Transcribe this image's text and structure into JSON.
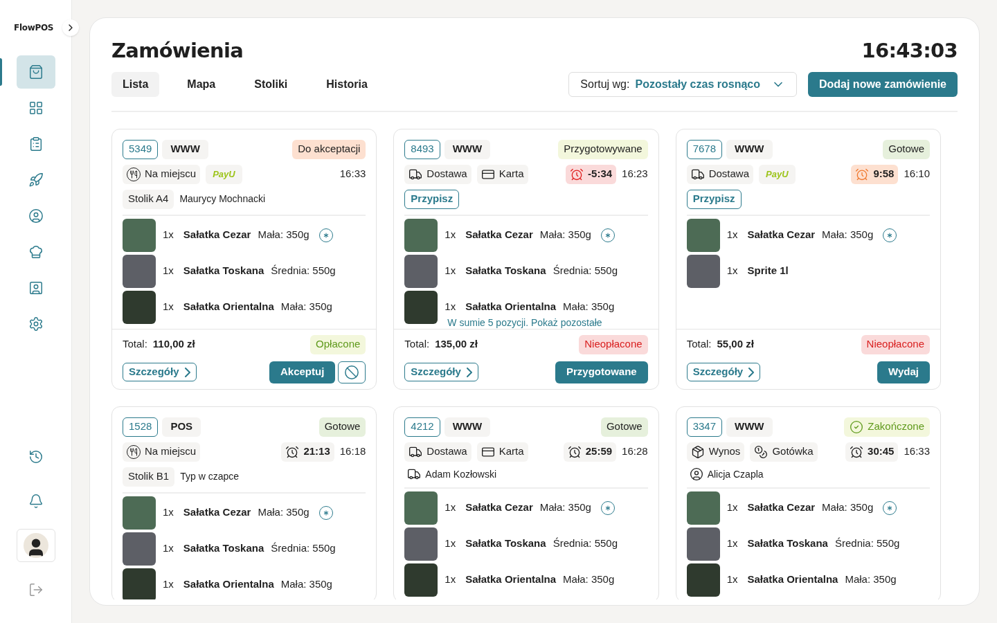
{
  "sidebar": {
    "logo": "FlowPOS",
    "nav_items": [
      {
        "selected": true
      },
      {
        "selected": false
      },
      {
        "selected": false
      },
      {
        "selected": false
      },
      {
        "selected": false
      },
      {
        "selected": false
      },
      {
        "selected": false
      },
      {
        "selected": false
      }
    ],
    "bottom_items": [
      {
        "kind": "history"
      },
      {
        "kind": "notifications"
      },
      {
        "kind": "avatar"
      },
      {
        "kind": "logout"
      }
    ]
  },
  "header": {
    "title": "Zamówienia",
    "clock": "16:43:03",
    "tabs": [
      {
        "label": "Lista",
        "selected": true
      },
      {
        "label": "Mapa",
        "selected": false
      },
      {
        "label": "Stoliki",
        "selected": false
      },
      {
        "label": "Historia",
        "selected": false
      }
    ],
    "sort": {
      "label": "Sortuj wg:",
      "value": "Pozostały czas rosnąco"
    },
    "add_button": "Dodaj nowe zamówienie"
  },
  "orders": [
    {
      "number": "5349",
      "channel": "WWW",
      "status": {
        "label": "Do akceptacji",
        "kind": "new"
      },
      "tags": [
        {
          "kind": "dine_in",
          "label": "Na miejscu"
        },
        {
          "kind": "payu",
          "label": "PayU"
        }
      ],
      "time": "16:33",
      "details": [
        {
          "kind": "table",
          "text": "Stolik A4"
        },
        {
          "kind": "name",
          "text": "Maurycy Mochnacki"
        }
      ],
      "items": [
        {
          "qty": "1x",
          "name": "Sałatka Cezar",
          "variant": "Mała: 350g",
          "note": true
        },
        {
          "qty": "1x",
          "name": "Sałatka Toskana",
          "variant": "Średnia: 550g",
          "note": false
        },
        {
          "qty": "1x",
          "name": "Sałatka Orientalna",
          "variant": "Mała: 350g",
          "note": false
        }
      ],
      "total_label": "Total:",
      "total": "110,00 zł",
      "payment": {
        "label": "Opłacone",
        "kind": "paid"
      },
      "details_button": "Szczegóły",
      "actions": [
        {
          "kind": "primary",
          "label": "Akceptuj"
        },
        {
          "kind": "reject"
        }
      ]
    },
    {
      "number": "8493",
      "channel": "WWW",
      "status": {
        "label": "Przygotowywane",
        "kind": "preparing"
      },
      "tags": [
        {
          "kind": "delivery",
          "label": "Dostawa"
        },
        {
          "kind": "card",
          "label": "Karta"
        }
      ],
      "timer": {
        "value": "-5:34",
        "kind": "overdue"
      },
      "time": "16:23",
      "details": [
        {
          "kind": "assign",
          "text": "Przypisz"
        }
      ],
      "items": [
        {
          "qty": "1x",
          "name": "Sałatka Cezar",
          "variant": "Mała: 350g",
          "note": true
        },
        {
          "qty": "1x",
          "name": "Sałatka Toskana",
          "variant": "Średnia: 550g",
          "note": false
        },
        {
          "qty": "1x",
          "name": "Sałatka Orientalna",
          "variant": "Mała: 350g",
          "note": false
        }
      ],
      "more_link": "W sumie 5 pozycji. Pokaż pozostałe",
      "total_label": "Total:",
      "total": "135,00 zł",
      "payment": {
        "label": "Nieopłacone",
        "kind": "unpaid"
      },
      "details_button": "Szczegóły",
      "actions": [
        {
          "kind": "primary",
          "label": "Przygotowane"
        }
      ]
    },
    {
      "number": "7678",
      "channel": "WWW",
      "status": {
        "label": "Gotowe",
        "kind": "ready"
      },
      "tags": [
        {
          "kind": "delivery",
          "label": "Dostawa"
        },
        {
          "kind": "payu",
          "label": "PayU"
        }
      ],
      "timer": {
        "value": "9:58",
        "kind": "warning"
      },
      "time": "16:10",
      "details": [
        {
          "kind": "assign",
          "text": "Przypisz"
        }
      ],
      "items": [
        {
          "qty": "1x",
          "name": "Sałatka Cezar",
          "variant": "Mała: 350g",
          "note": true
        },
        {
          "qty": "1x",
          "name": "Sprite 1l",
          "note": false
        }
      ],
      "total_label": "Total:",
      "total": "55,00 zł",
      "payment": {
        "label": "Nieopłacone",
        "kind": "unpaid"
      },
      "details_button": "Szczegóły",
      "actions": [
        {
          "kind": "primary",
          "label": "Wydaj"
        }
      ]
    },
    {
      "number": "1528",
      "channel": "POS",
      "status": {
        "label": "Gotowe",
        "kind": "ready"
      },
      "tags": [
        {
          "kind": "dine_in",
          "label": "Na miejscu"
        }
      ],
      "timer": {
        "value": "21:13",
        "kind": "normal"
      },
      "time": "16:18",
      "details": [
        {
          "kind": "table",
          "text": "Stolik B1"
        },
        {
          "kind": "name",
          "text": "Typ w czapce"
        }
      ],
      "items": [
        {
          "qty": "1x",
          "name": "Sałatka Cezar",
          "variant": "Mała: 350g",
          "note": true
        },
        {
          "qty": "1x",
          "name": "Sałatka Toskana",
          "variant": "Średnia: 550g",
          "note": false
        },
        {
          "qty": "1x",
          "name": "Sałatka Orientalna",
          "variant": "Mała: 350g",
          "note": false
        }
      ]
    },
    {
      "number": "4212",
      "channel": "WWW",
      "status": {
        "label": "Gotowe",
        "kind": "ready"
      },
      "tags": [
        {
          "kind": "delivery",
          "label": "Dostawa"
        },
        {
          "kind": "card",
          "label": "Karta"
        }
      ],
      "timer": {
        "value": "25:59",
        "kind": "normal"
      },
      "time": "16:28",
      "details": [
        {
          "kind": "courier",
          "text": "Adam Kozłowski"
        }
      ],
      "items": [
        {
          "qty": "1x",
          "name": "Sałatka Cezar",
          "variant": "Mała: 350g",
          "note": true
        },
        {
          "qty": "1x",
          "name": "Sałatka Toskana",
          "variant": "Średnia: 550g",
          "note": false
        },
        {
          "qty": "1x",
          "name": "Sałatka Orientalna",
          "variant": "Mała: 350g",
          "note": false
        }
      ]
    },
    {
      "number": "3347",
      "channel": "WWW",
      "status": {
        "label": "Zakończone",
        "kind": "done"
      },
      "tags": [
        {
          "kind": "takeaway",
          "label": "Wynos"
        },
        {
          "kind": "cash",
          "label": "Gotówka"
        }
      ],
      "timer": {
        "value": "30:45",
        "kind": "normal"
      },
      "time": "16:33",
      "details": [
        {
          "kind": "customer",
          "text": "Alicja Czapla"
        }
      ],
      "items": [
        {
          "qty": "1x",
          "name": "Sałatka Cezar",
          "variant": "Mała: 350g",
          "note": true
        },
        {
          "qty": "1x",
          "name": "Sałatka Toskana",
          "variant": "Średnia: 550g",
          "note": false
        },
        {
          "qty": "1x",
          "name": "Sałatka Orientalna",
          "variant": "Mała: 350g",
          "note": false
        }
      ]
    }
  ]
}
